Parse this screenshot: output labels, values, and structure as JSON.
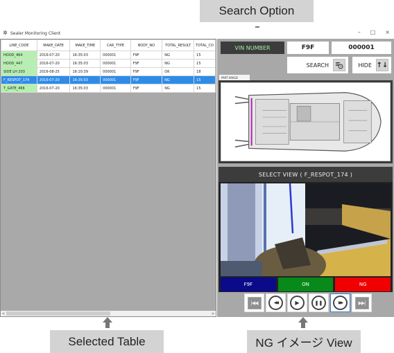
{
  "callouts": {
    "search_option": "Search Option",
    "selected_table": "Selected Table",
    "ng_image_view": "NG イメージ View"
  },
  "window": {
    "title": "Sealer Monitoring Client",
    "app_icon": "gear-cluster-icon",
    "controls": {
      "minimize": "–",
      "maximize": "□",
      "close": "×"
    }
  },
  "table": {
    "columns": [
      "LINE_CODE",
      "MAKE_DATE",
      "MAKE_TIME",
      "CAR_TYPE",
      "BODY_NO",
      "TOTAL_RESULT",
      "TOTAL_CO"
    ],
    "rows": [
      {
        "line_code": "HOOD_464",
        "make_date": "2016-07-20",
        "make_time": "16:35:03",
        "car_type": "000001",
        "body_no": "F9F",
        "total_result": "NG",
        "total_co": "15",
        "selected": false
      },
      {
        "line_code": "HOOD_447",
        "make_date": "2016-07-20",
        "make_time": "16:35:03",
        "car_type": "000001",
        "body_no": "F9F",
        "total_result": "NG",
        "total_co": "15",
        "selected": false
      },
      {
        "line_code": "SIDE LH 203",
        "make_date": "2016-08-25",
        "make_time": "16:10:39",
        "car_type": "000001",
        "body_no": "F9F",
        "total_result": "OK",
        "total_co": "18",
        "selected": false
      },
      {
        "line_code": "F_RESPOT_174",
        "make_date": "2016-07-20",
        "make_time": "16:35:03",
        "car_type": "000001",
        "body_no": "F9F",
        "total_result": "NG",
        "total_co": "15",
        "selected": true
      },
      {
        "line_code": "T_GATE_466",
        "make_date": "2016-07-20",
        "make_time": "16:35:03",
        "car_type": "000001",
        "body_no": "F9F",
        "total_result": "NG",
        "total_co": "15",
        "selected": false
      }
    ],
    "scroll_left": "<",
    "scroll_right": ">"
  },
  "search": {
    "vin_label": "VIN NUMBER",
    "vin_body": "F9F",
    "vin_serial": "000001",
    "search_label": "SEARCH",
    "search_icon": "search-history-icon",
    "hide_label": "HIDE",
    "hide_icon": "sort-updown-icon"
  },
  "part_image": {
    "tab_label": "PART IMAGE",
    "description": "car-body-top-view"
  },
  "view": {
    "title": "SELECT VIEW ( F_RESPOT_174 )",
    "status": [
      {
        "label": "F9F",
        "color": "#0a0a8a"
      },
      {
        "label": "ON",
        "color": "#078a1a"
      },
      {
        "label": "NG",
        "color": "#f00000"
      }
    ],
    "playback": [
      {
        "name": "skip-to-start",
        "glyph": "|◀◀"
      },
      {
        "name": "rewind",
        "glyph": "◀◀"
      },
      {
        "name": "play",
        "glyph": "▶"
      },
      {
        "name": "pause",
        "glyph": "❚❚"
      },
      {
        "name": "fast-forward",
        "glyph": "▶▶"
      },
      {
        "name": "skip-to-end",
        "glyph": "▶▶|"
      }
    ]
  },
  "colors": {
    "selected_row": "#2e8ce8",
    "line_code_bg": "#b6f0b0",
    "vin_label_text": "#a6e8a0",
    "panel_bg": "#a8a8a8"
  }
}
